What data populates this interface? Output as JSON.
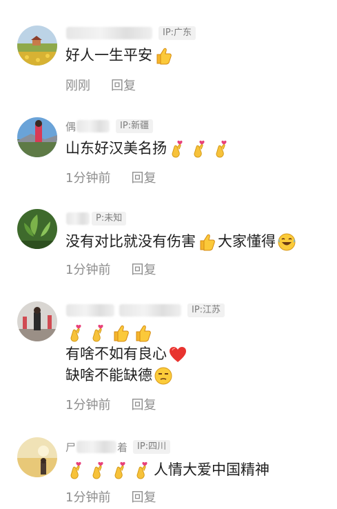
{
  "comments": [
    {
      "ip": "IP:广东",
      "name_suffix": "",
      "lines": [
        [
          "好人一生平安",
          "thumbs-up"
        ]
      ],
      "time": "刚刚",
      "reply": "回复"
    },
    {
      "ip": "IP:新疆",
      "name_prefix": "偶",
      "lines": [
        [
          "山东好汉美名扬",
          "finger-heart",
          "finger-heart",
          "finger-heart"
        ]
      ],
      "time": "1分钟前",
      "reply": "回复"
    },
    {
      "ip": "P:未知",
      "lines": [
        [
          "没有对比就没有伤害",
          "thumbs-up",
          "大家懂得",
          "rolling-laugh"
        ]
      ],
      "time": "1分钟前",
      "reply": "回复"
    },
    {
      "ip": "IP:江苏",
      "lines": [
        [
          "finger-heart",
          "finger-heart",
          "thumbs-up",
          "thumbs-up"
        ],
        [
          "有啥不如有良心",
          "red-heart"
        ],
        [
          "缺啥不能缺德",
          "unamused-face"
        ]
      ],
      "time": "1分钟前",
      "reply": "回复"
    },
    {
      "ip": "IP:四川",
      "name_prefix": "尸",
      "name_suffix": "着",
      "lines": [
        [
          "finger-heart",
          "finger-heart",
          "finger-heart",
          "finger-heart",
          "人情大爱中国精神"
        ]
      ],
      "time": "1分钟前",
      "reply": "回复"
    }
  ],
  "texts": {
    "c1_l1": "好人一生平安",
    "c2_l1": "山东好汉美名扬",
    "c3_l1a": "没有对比就没有伤害",
    "c3_l1b": "大家懂得",
    "c4_l2": "有啥不如有良心",
    "c4_l3": "缺啥不能缺德",
    "c5_l1": "人情大爱中国精神",
    "c2_prefix": "偶",
    "c5_prefix": "尸",
    "c5_suffix": "着"
  },
  "icons": {
    "thumbs_up": "thumbs-up-icon",
    "finger_heart": "finger-heart-icon",
    "rolling_laugh": "rolling-laugh-icon",
    "red_heart": "red-heart-icon",
    "unamused": "unamused-face-icon"
  },
  "colors": {
    "text": "#1e1e1e",
    "secondary": "#8d8d8d",
    "ip_bg": "#f1f1f1",
    "emoji_yellow": "#f7c23a",
    "heart_red": "#e8332f"
  }
}
